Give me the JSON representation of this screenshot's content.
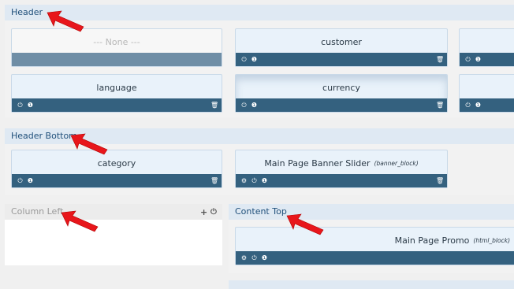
{
  "sections": {
    "header": {
      "title": "Header",
      "blocks": [
        {
          "label": "--- None ---",
          "sub": ""
        },
        {
          "label": "customer",
          "sub": ""
        },
        {
          "label": "language",
          "sub": ""
        },
        {
          "label": "currency",
          "sub": ""
        }
      ]
    },
    "header_bottom": {
      "title": "Header Bottom",
      "blocks": [
        {
          "label": "category",
          "sub": ""
        },
        {
          "label": "Main Page Banner Slider",
          "sub": "(banner_block)"
        }
      ]
    },
    "column_left": {
      "title": "Column Left",
      "add_icon": "plus-icon",
      "power_icon": "power-icon"
    },
    "content_top": {
      "title": "Content Top",
      "blocks": [
        {
          "label": "Main Page Promo",
          "sub": "(html_block)"
        }
      ]
    }
  },
  "icons": {
    "power": "power-icon",
    "info": "info-icon",
    "delete": "trash-icon",
    "settings": "gear-icon",
    "annotation": "red-arrow-icon"
  },
  "colors": {
    "bar": "#34617f",
    "bar_none": "#6f8ea6",
    "section_head": "#dfe9f3",
    "arrow": "#e8161b"
  }
}
